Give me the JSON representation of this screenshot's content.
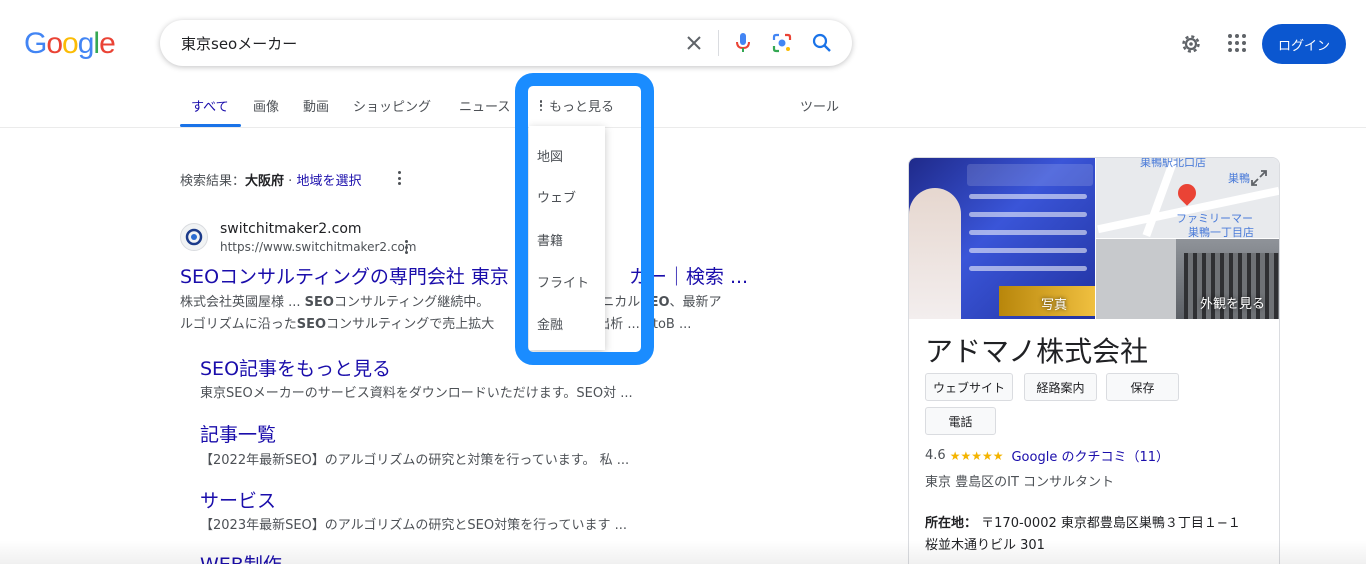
{
  "logo": {
    "text": "Google"
  },
  "search": {
    "query": "東京seoメーカー"
  },
  "header": {
    "login_label": "ログイン"
  },
  "tabs": [
    {
      "label": "すべて",
      "active": true
    },
    {
      "label": "画像"
    },
    {
      "label": "動画"
    },
    {
      "label": "ショッピング"
    },
    {
      "label": "ニュース"
    }
  ],
  "more": {
    "label": "もっと見る",
    "items": [
      "地図",
      "ウェブ",
      "書籍",
      "フライト",
      "金融"
    ],
    "highlight_color": "#1a8cff"
  },
  "tools_label": "ツール",
  "region": {
    "prefix": "検索結果：",
    "place": "大阪府",
    "sep": "·",
    "link": "地域を選択"
  },
  "result": {
    "site_name": "switchitmaker2.com",
    "url": "https://www.switchitmaker2.com",
    "title": "SEOコンサルティングの専門会社 東京",
    "title_tail": "カー｜検索 ...",
    "snippet_line1_a": "株式会社英國屋様 ... ",
    "snippet_line1_b": "SEO",
    "snippet_line1_c": "コンサルティング継続中。",
    "snippet_line1_d": "テクニカル",
    "snippet_line1_e": "SEO",
    "snippet_line1_f": "、最新ア",
    "snippet_line2_a": "ルゴリズムに沿った",
    "snippet_line2_b": "SEO",
    "snippet_line2_c": "コンサルティングで売上拡大",
    "snippet_line2_d": "生出析 ... BtoB ..."
  },
  "sitelinks": [
    {
      "title": "SEO記事をもっと見る",
      "snippet": "東京SEOメーカーのサービス資料をダウンロードいただけます。SEO対 ..."
    },
    {
      "title": "記事一覧",
      "snippet": "【2022年最新SEO】のアルゴリズムの研究と対策を行っています。 私 ..."
    },
    {
      "title": "サービス",
      "snippet": "【2023年最新SEO】のアルゴリズムの研究とSEO対策を行っています ..."
    },
    {
      "title": "WEB制作",
      "snippet": ""
    }
  ],
  "knowledge_panel": {
    "photo_label": "写真",
    "street_label": "外観を見る",
    "map_labels": [
      "巣鴨駅北口店",
      "巣鴨",
      "ファミリーマー",
      "巣鴨一丁目店"
    ],
    "title": "アドマノ株式会社",
    "buttons": [
      "ウェブサイト",
      "経路案内",
      "保存",
      "電話"
    ],
    "rating": "4.6",
    "stars": "★★★★★",
    "review_link": "Google のクチコミ（11）",
    "category": "東京 豊島区のIT コンサルタント",
    "address_label": "所在地：",
    "address": "〒170-0002 東京都豊島区巣鴨３丁目１−１",
    "address_line2": "桜並木通りビル 301"
  },
  "colors": {
    "accent": "#1a73e8",
    "link": "#1a0dab",
    "login_bg": "#0b57d0"
  }
}
